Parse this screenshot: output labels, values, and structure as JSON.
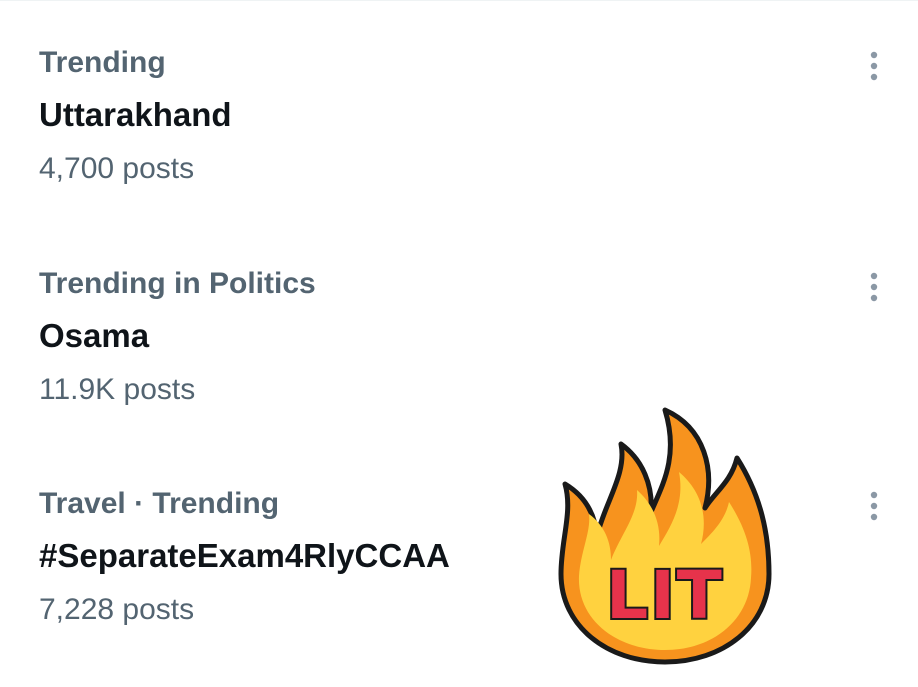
{
  "trends": [
    {
      "context": "Trending",
      "title": "Uttarakhand",
      "count": "4,700 posts"
    },
    {
      "context": "Trending in Politics",
      "title": "Osama",
      "count": "11.9K posts"
    },
    {
      "context": "Travel · Trending",
      "title": "#SeparateExam4RlyCCAA",
      "count": "7,228 posts"
    }
  ],
  "icons": {
    "more": "more-vertical-icon"
  },
  "colors": {
    "primary_text": "#0f1419",
    "secondary_text": "#536471",
    "icon": "#8b98a5",
    "flame_outer": "#f7931e",
    "flame_inner": "#ffd23f",
    "sticker_text": "#e6334b"
  },
  "sticker": {
    "text": "LIT"
  }
}
